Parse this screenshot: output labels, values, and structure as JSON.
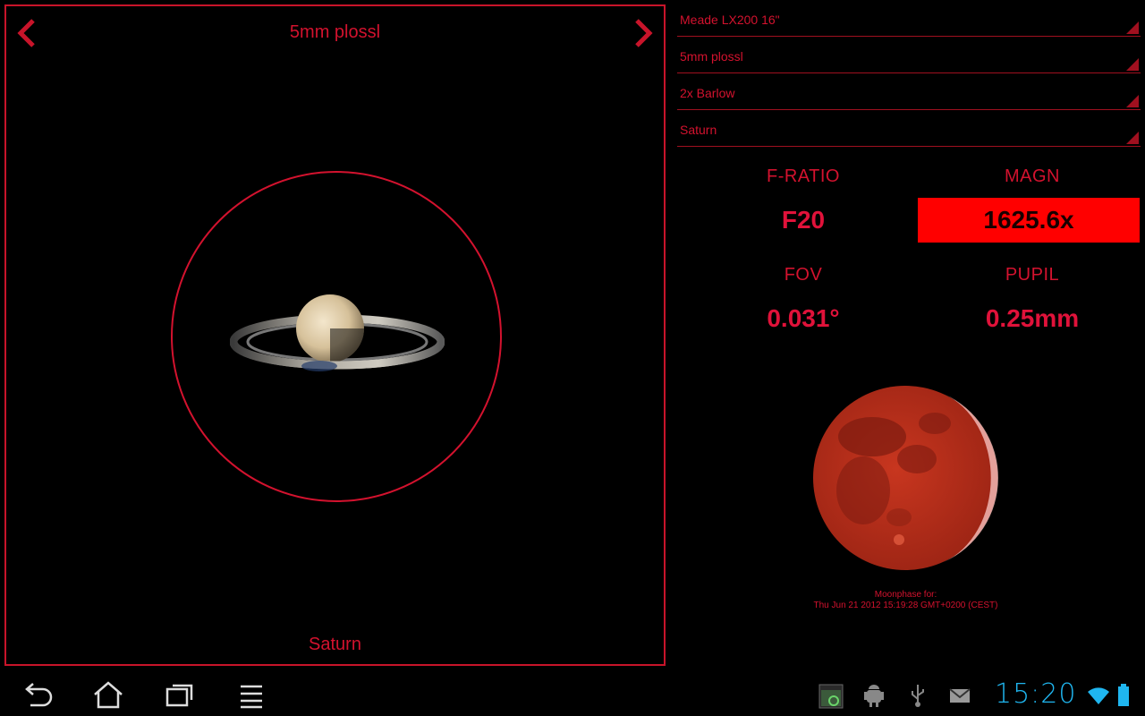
{
  "viewer": {
    "title": "5mm plossl",
    "footer": "Saturn"
  },
  "selectors": [
    {
      "label": "Meade LX200 16\""
    },
    {
      "label": "5mm plossl"
    },
    {
      "label": "2x Barlow"
    },
    {
      "label": "Saturn"
    }
  ],
  "stats": {
    "fratio": {
      "label": "F-RATIO",
      "value": "F20"
    },
    "magn": {
      "label": "MAGN",
      "value": "1625.6x"
    },
    "fov": {
      "label": "FOV",
      "value": "0.031°"
    },
    "pupil": {
      "label": "PUPIL",
      "value": "0.25mm"
    }
  },
  "moon": {
    "caption_line1": "Moonphase for:",
    "caption_line2": "Thu Jun 21 2012 15:19:28 GMT+0200 (CEST)"
  },
  "statusbar": {
    "time": "15:20"
  },
  "colors": {
    "accent_red": "#d3122e",
    "highlight_red": "#ff0000",
    "clock_blue": "#1fb6f0"
  },
  "icons": [
    "chevron-left-icon",
    "chevron-right-icon",
    "back-icon",
    "home-icon",
    "recent-apps-icon",
    "menu-icon",
    "screenshot-icon",
    "android-debug-icon",
    "usb-icon",
    "mail-icon",
    "wifi-icon",
    "battery-icon"
  ]
}
